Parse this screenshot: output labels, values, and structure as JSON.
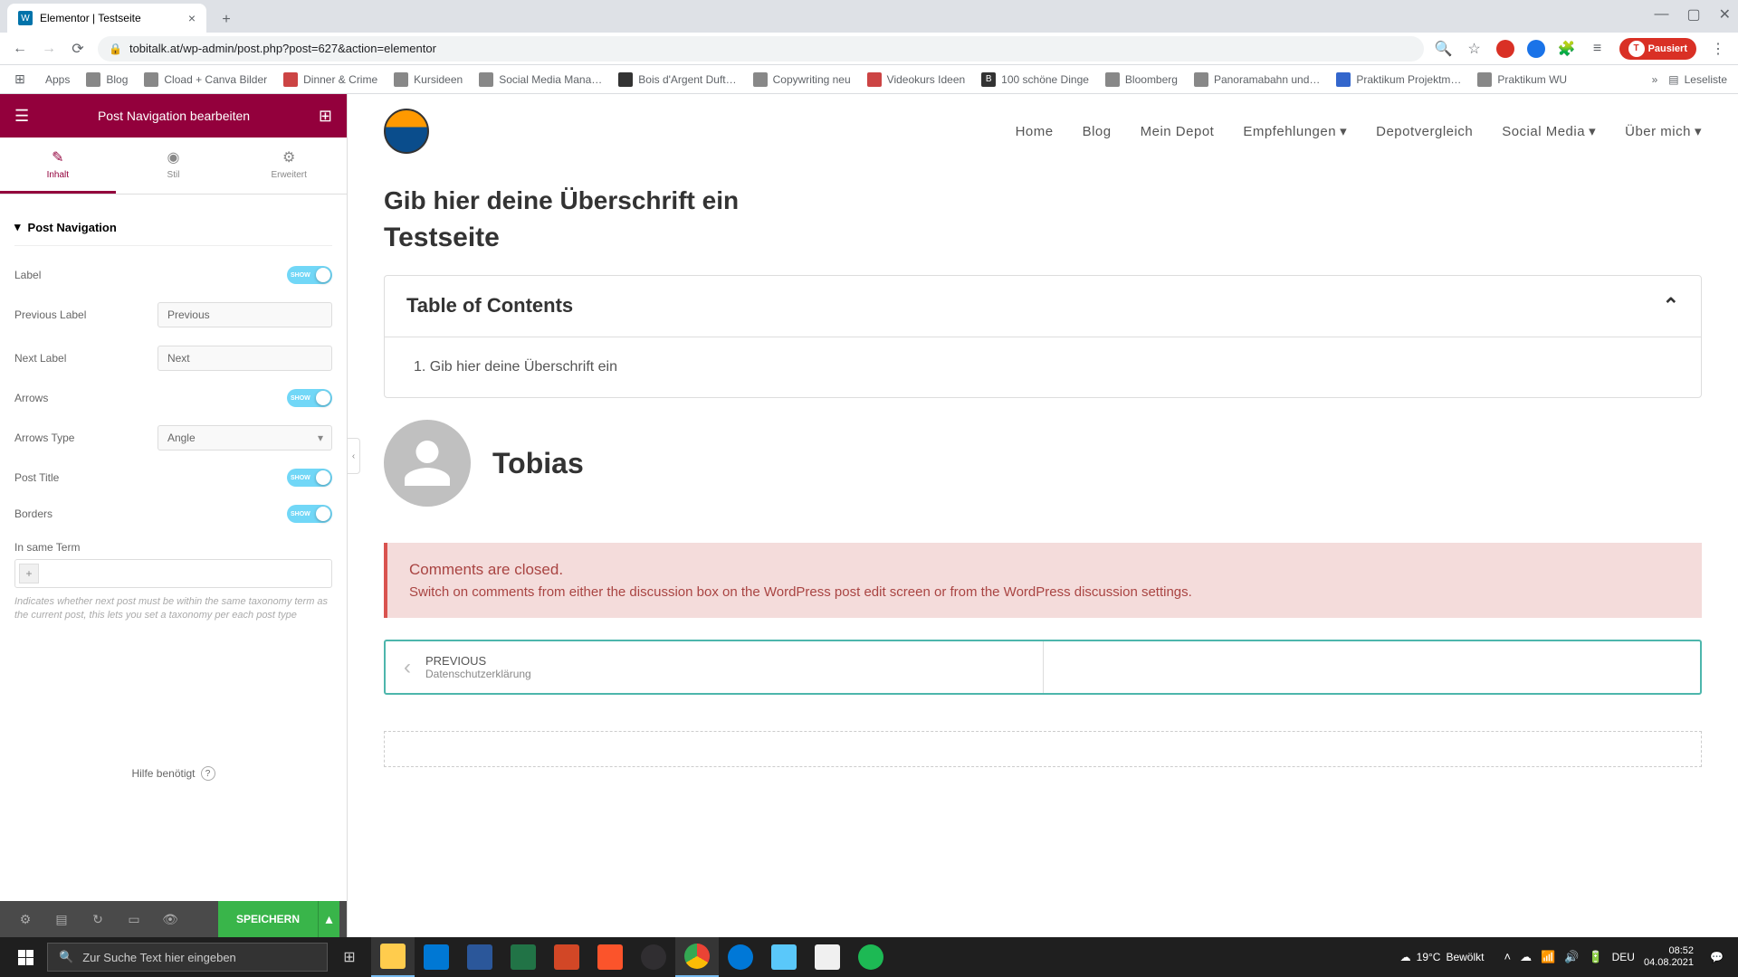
{
  "browser": {
    "tab_title": "Elementor | Testseite",
    "url": "tobitalk.at/wp-admin/post.php?post=627&action=elementor",
    "profile_status": "Pausiert",
    "bookmarks": [
      "Apps",
      "Blog",
      "Cload + Canva Bilder",
      "Dinner & Crime",
      "Kursideen",
      "Social Media Mana…",
      "Bois d'Argent Duft…",
      "Copywriting neu",
      "Videokurs Ideen",
      "100 schöne Dinge",
      "Bloomberg",
      "Panoramabahn und…",
      "Praktikum Projektm…",
      "Praktikum WU"
    ],
    "reading_list": "Leseliste"
  },
  "sidebar": {
    "title": "Post Navigation bearbeiten",
    "tabs": {
      "content": "Inhalt",
      "style": "Stil",
      "advanced": "Erweitert"
    },
    "section_title": "Post Navigation",
    "controls": {
      "label": "Label",
      "prev_label": "Previous Label",
      "prev_value": "Previous",
      "next_label": "Next Label",
      "next_value": "Next",
      "arrows": "Arrows",
      "arrows_type": "Arrows Type",
      "arrows_type_value": "Angle",
      "post_title": "Post Title",
      "borders": "Borders",
      "same_term": "In same Term",
      "toggle_show": "SHOW",
      "help_text": "Indicates whether next post must be within the same taxonomy term as the current post, this lets you set a taxonomy per each post type"
    },
    "help_link": "Hilfe benötigt",
    "save_button": "SPEICHERN"
  },
  "preview": {
    "nav": [
      "Home",
      "Blog",
      "Mein Depot",
      "Empfehlungen",
      "Depotvergleich",
      "Social Media",
      "Über mich"
    ],
    "heading": "Gib hier deine Überschrift ein",
    "page_title": "Testseite",
    "toc_title": "Table of Contents",
    "toc_item": "1.   Gib hier deine Überschrift ein",
    "author_name": "Tobias",
    "comments_closed": "Comments are closed.",
    "comments_hint": "Switch on comments from either the discussion box on the WordPress post edit screen or from the WordPress discussion settings.",
    "prev_label": "PREVIOUS",
    "prev_title": "Datenschutzerklärung"
  },
  "taskbar": {
    "search_placeholder": "Zur Suche Text hier eingeben",
    "weather_temp": "19°C",
    "weather_desc": "Bewölkt",
    "lang": "DEU",
    "time": "08:52",
    "date": "04.08.2021"
  }
}
